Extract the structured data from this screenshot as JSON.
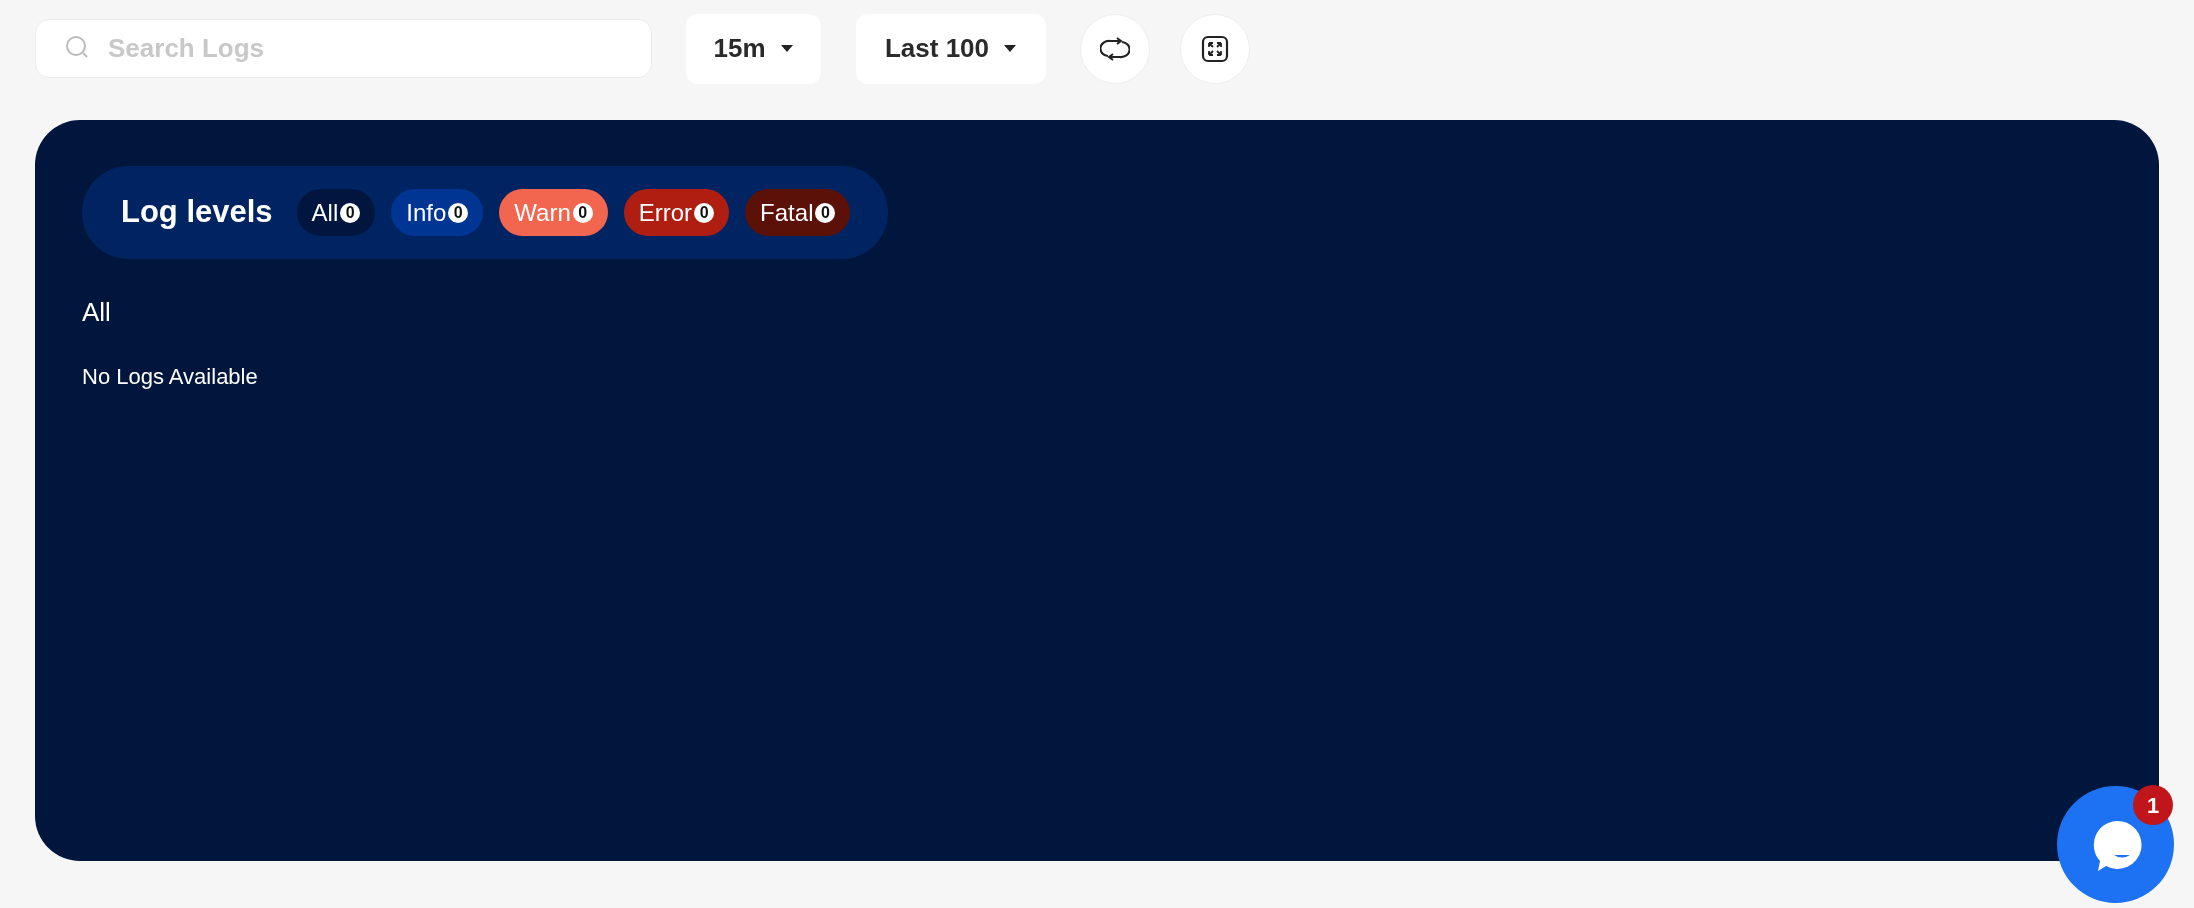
{
  "toolbar": {
    "search": {
      "placeholder": "Search Logs"
    },
    "time_range": "15m",
    "limit": "Last 100"
  },
  "log_levels": {
    "title": "Log levels",
    "levels": [
      {
        "label": "All",
        "count": "0",
        "color": "#00163f"
      },
      {
        "label": "Info",
        "count": "0",
        "color": "#003594"
      },
      {
        "label": "Warn",
        "count": "0",
        "color": "#f26650"
      },
      {
        "label": "Error",
        "count": "0",
        "color": "#b01e12"
      },
      {
        "label": "Fatal",
        "count": "0",
        "color": "#5b1108"
      }
    ]
  },
  "section_title": "All",
  "empty_message": "No Logs Available",
  "chat": {
    "badge": "1"
  }
}
